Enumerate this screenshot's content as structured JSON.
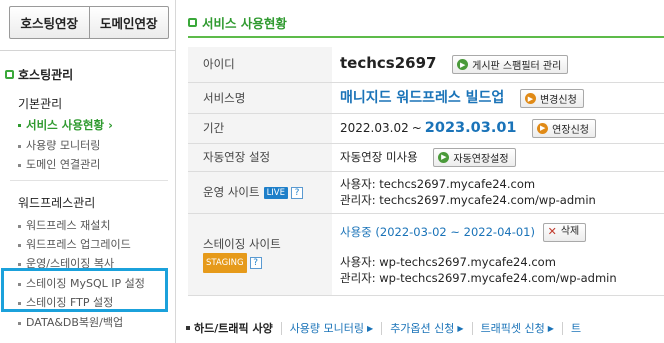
{
  "sidebar": {
    "top_buttons": [
      "호스팅연장",
      "도메인연장"
    ],
    "section_title": "호스팅관리",
    "groups": [
      {
        "title": "기본관리",
        "items": [
          {
            "label": "서비스 사용현황",
            "active": true,
            "suffix": "›"
          },
          {
            "label": "사용량 모니터링",
            "active": false
          },
          {
            "label": "도메인 연결관리",
            "active": false
          }
        ]
      },
      {
        "title": "워드프레스관리",
        "items": [
          {
            "label": "워드프레스 재설치",
            "active": false
          },
          {
            "label": "워드프레스 업그레이드",
            "active": false
          },
          {
            "label": "운영/스테이징 복사",
            "active": false
          },
          {
            "label": "스테이징 MySQL IP 설정",
            "active": false
          },
          {
            "label": "스테이징 FTP 설정",
            "active": false
          },
          {
            "label": "DATA&DB복원/백업",
            "active": false
          }
        ]
      }
    ]
  },
  "main": {
    "title": "서비스 사용현황",
    "rows": {
      "id": {
        "label": "아이디",
        "value": "techcs2697",
        "button": "게시판 스팸필터 관리"
      },
      "service": {
        "label": "서비스명",
        "value": "매니지드 워드프레스 빌드업",
        "button": "변경신청"
      },
      "period": {
        "label": "기간",
        "start": "2022.03.02",
        "arrow": "~",
        "end": "2023.03.01",
        "button": "연장신청"
      },
      "auto": {
        "label": "자동연장 설정",
        "value": "자동연장 미사용",
        "button": "자동연장설정"
      },
      "live": {
        "label": "운영 사이트",
        "badge": "LIVE",
        "help": "?",
        "user_line": "사용자: techcs2697.mycafe24.com",
        "admin_line": "관리자: techcs2697.mycafe24.com/wp-admin"
      },
      "staging": {
        "label": "스테이징 사이트",
        "badge": "STAGING",
        "help": "?",
        "status": "사용중 (2022-03-02 ~ 2022-04-01)",
        "button": "삭제",
        "user_line": "사용자: wp-techcs2697.mycafe24.com",
        "admin_line": "관리자: wp-techcs2697.mycafe24.com/wp-admin"
      }
    },
    "tabs": [
      "하드/트래픽 사양",
      "사용량 모니터링",
      "추가옵션 신청",
      "트래픽셋 신청",
      "트"
    ]
  },
  "colors": {
    "accent_green": "#2f9a2f",
    "link_blue": "#1a73b8",
    "highlight_blue": "#1ba1db",
    "live_badge": "#1e7fc9",
    "staging_badge": "#e69a1a"
  }
}
